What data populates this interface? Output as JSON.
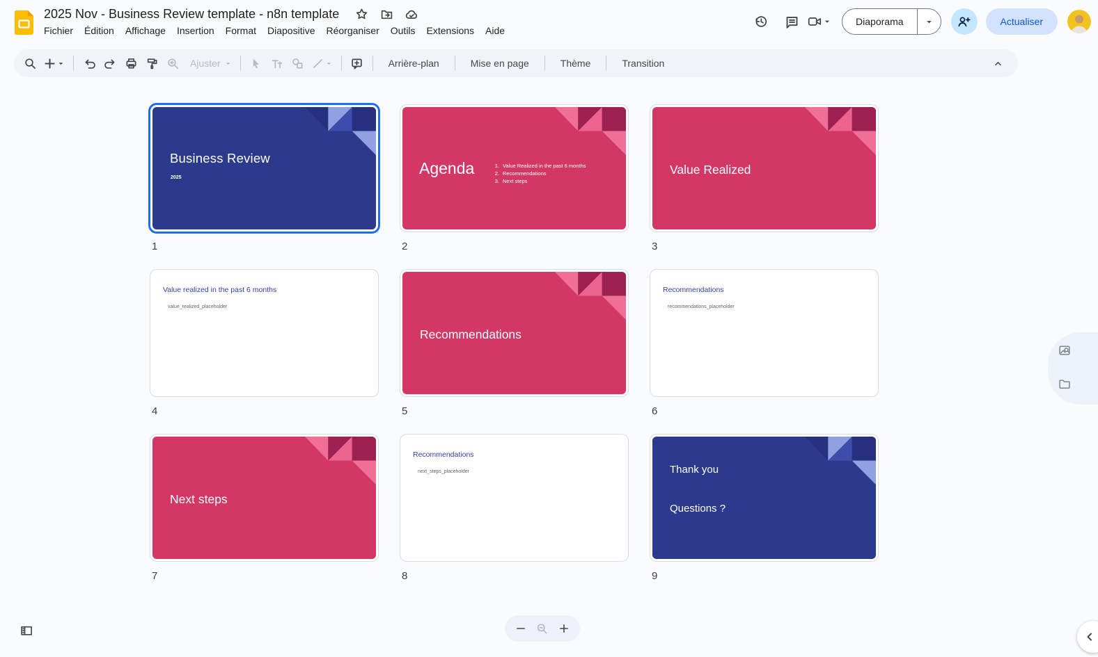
{
  "header": {
    "title": "2025 Nov - Business Review template - n8n template",
    "menus": [
      "Fichier",
      "Édition",
      "Affichage",
      "Insertion",
      "Format",
      "Diapositive",
      "Réorganiser",
      "Outils",
      "Extensions",
      "Aide"
    ],
    "present_label": "Diaporama",
    "refresh_label": "Actualiser"
  },
  "toolbar": {
    "fit_label": "Ajuster",
    "background_label": "Arrière-plan",
    "layout_label": "Mise en page",
    "theme_label": "Thème",
    "transition_label": "Transition"
  },
  "slides": [
    {
      "number": "1",
      "variant": "blue",
      "layout": "title",
      "selected": true,
      "title": "Business Review",
      "subtitle": "2025"
    },
    {
      "number": "2",
      "variant": "pink",
      "layout": "agenda",
      "selected": false,
      "title": "Agenda",
      "list": [
        {
          "n": "1.",
          "text": "Value Realized in the past 6 months"
        },
        {
          "n": "2.",
          "text": "Recommendations"
        },
        {
          "n": "3.",
          "text": "Next steps"
        }
      ]
    },
    {
      "number": "3",
      "variant": "pink",
      "layout": "section",
      "selected": false,
      "title": "Value Realized"
    },
    {
      "number": "4",
      "variant": "white",
      "layout": "content",
      "selected": false,
      "title": "Value realized in the past 6 months",
      "body": "value_realized_placeholder"
    },
    {
      "number": "5",
      "variant": "pink",
      "layout": "section",
      "selected": false,
      "title": "Recommendations"
    },
    {
      "number": "6",
      "variant": "white",
      "layout": "content",
      "selected": false,
      "title": "Recommendations",
      "body": "recommendations_placeholder"
    },
    {
      "number": "7",
      "variant": "pink",
      "layout": "section",
      "selected": false,
      "title": "Next steps"
    },
    {
      "number": "8",
      "variant": "white",
      "layout": "content",
      "selected": false,
      "title": "Recommendations",
      "body": "next_steps_placeholder"
    },
    {
      "number": "9",
      "variant": "blue",
      "layout": "thanks",
      "selected": false,
      "title": "Thank you",
      "subtitle": "Questions ?"
    }
  ],
  "colors": {
    "selection_blue": "#1b6ef3",
    "slide_blue": "#2c3a8d",
    "slide_pink": "#d23765",
    "title_indigo": "#3340a3",
    "corner_blue": [
      "#27307f",
      "#8fa1e0",
      "#3e4dac",
      "#27307f",
      "#8fa1e0"
    ],
    "corner_pink": [
      "#ef6f97",
      "#9d2150",
      "#ec6390",
      "#9d2150",
      "#ef6f97"
    ],
    "refresh_bg": "#d3e3fd",
    "refresh_text": "#0b57d0",
    "share_bg": "#c2e7ff"
  },
  "icons": {
    "search-icon": "magnifier",
    "new-slide-icon": "plus",
    "undo-icon": "curved-arrow-left",
    "redo-icon": "curved-arrow-right",
    "print-icon": "printer",
    "paint-format-icon": "paint-roller",
    "zoom-in-icon": "magnifier-plus",
    "select-icon": "cursor-arrow",
    "text-icon": "Tt",
    "shape-icon": "circle-square",
    "line-icon": "diagonal-line",
    "comment-add-icon": "speech-bubble-plus",
    "version-history-icon": "clock-arrow",
    "comments-icon": "speech-bubble-lines",
    "camera-icon": "video-camera",
    "share-icon": "person-plus",
    "star-icon": "star-outline",
    "move-icon": "folder-arrow",
    "cloud-icon": "cloud-check",
    "grid-toggle-icon": "filmstrip",
    "zoom-out-icon": "minus",
    "zoom-reset-icon": "magnifier-minus",
    "zoom-plus-icon": "plus",
    "image-search-icon": "image-magnifier",
    "folder-icon": "folder",
    "panel-collapse-icon": "chevron-left",
    "toolbar-collapse-icon": "chevron-up",
    "caret-icon": "triangle-down"
  }
}
